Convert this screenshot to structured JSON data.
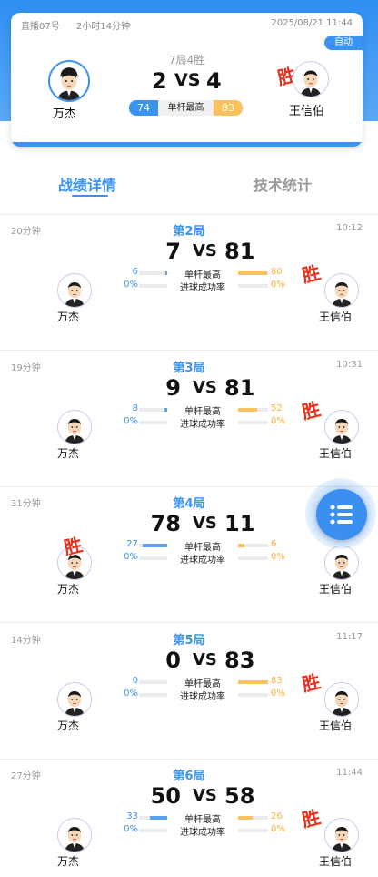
{
  "summary": {
    "room": "直播07号",
    "duration": "2小时14分钟",
    "datetime": "2025/08/21 11:44",
    "auto_label": "自动",
    "frames_label": "7局4胜",
    "score_left": "2",
    "vs": "VS",
    "score_right": "4",
    "high_break_left": "74",
    "high_break_label": "单杆最高",
    "high_break_right": "83",
    "winner_stamp": "胜",
    "player_left": "万杰",
    "player_right": "王信伯"
  },
  "tabs": [
    {
      "label": "战绩详情",
      "active": true
    },
    {
      "label": "技术统计",
      "active": false
    }
  ],
  "stat_labels": {
    "high_break": "单杆最高",
    "pot_rate": "进球成功率"
  },
  "frames": [
    {
      "title": "第2局",
      "duration": "20分钟",
      "time": "10:12",
      "score_left": "7",
      "score_right": "81",
      "hb_left": "6",
      "hb_right": "80",
      "hb_left_fill": 0.08,
      "hb_right_fill": 0.96,
      "pot_left": "0%",
      "pot_right": "0%",
      "winner": "right",
      "player_left": "万杰",
      "player_right": "王信伯"
    },
    {
      "title": "第3局",
      "duration": "19分钟",
      "time": "10:31",
      "score_left": "9",
      "score_right": "81",
      "hb_left": "8",
      "hb_right": "52",
      "hb_left_fill": 0.1,
      "hb_right_fill": 0.63,
      "pot_left": "0%",
      "pot_right": "0%",
      "winner": "right",
      "player_left": "万杰",
      "player_right": "王信伯"
    },
    {
      "title": "第4局",
      "duration": "31分钟",
      "time": "",
      "score_left": "78",
      "score_right": "11",
      "hb_left": "27",
      "hb_right": "6",
      "hb_left_fill": 0.87,
      "hb_right_fill": 0.2,
      "pot_left": "0%",
      "pot_right": "0%",
      "winner": "left",
      "player_left": "万杰",
      "player_right": "王信伯"
    },
    {
      "title": "第5局",
      "duration": "14分钟",
      "time": "11:17",
      "score_left": "0",
      "score_right": "83",
      "hb_left": "0",
      "hb_right": "83",
      "hb_left_fill": 0.0,
      "hb_right_fill": 1.0,
      "pot_left": "0%",
      "pot_right": "0%",
      "winner": "right",
      "player_left": "万杰",
      "player_right": "王信伯"
    },
    {
      "title": "第6局",
      "duration": "27分钟",
      "time": "11:44",
      "score_left": "50",
      "score_right": "58",
      "hb_left": "33",
      "hb_right": "26",
      "hb_left_fill": 0.6,
      "hb_right_fill": 0.47,
      "pot_left": "0%",
      "pot_right": "0%",
      "winner": "right",
      "player_left": "万杰",
      "player_right": "王信伯"
    }
  ],
  "fab": {
    "icon": "list-menu-icon"
  },
  "colors": {
    "primary": "#3b93f1",
    "accent": "#fbc15c",
    "win": "#e8321e"
  }
}
